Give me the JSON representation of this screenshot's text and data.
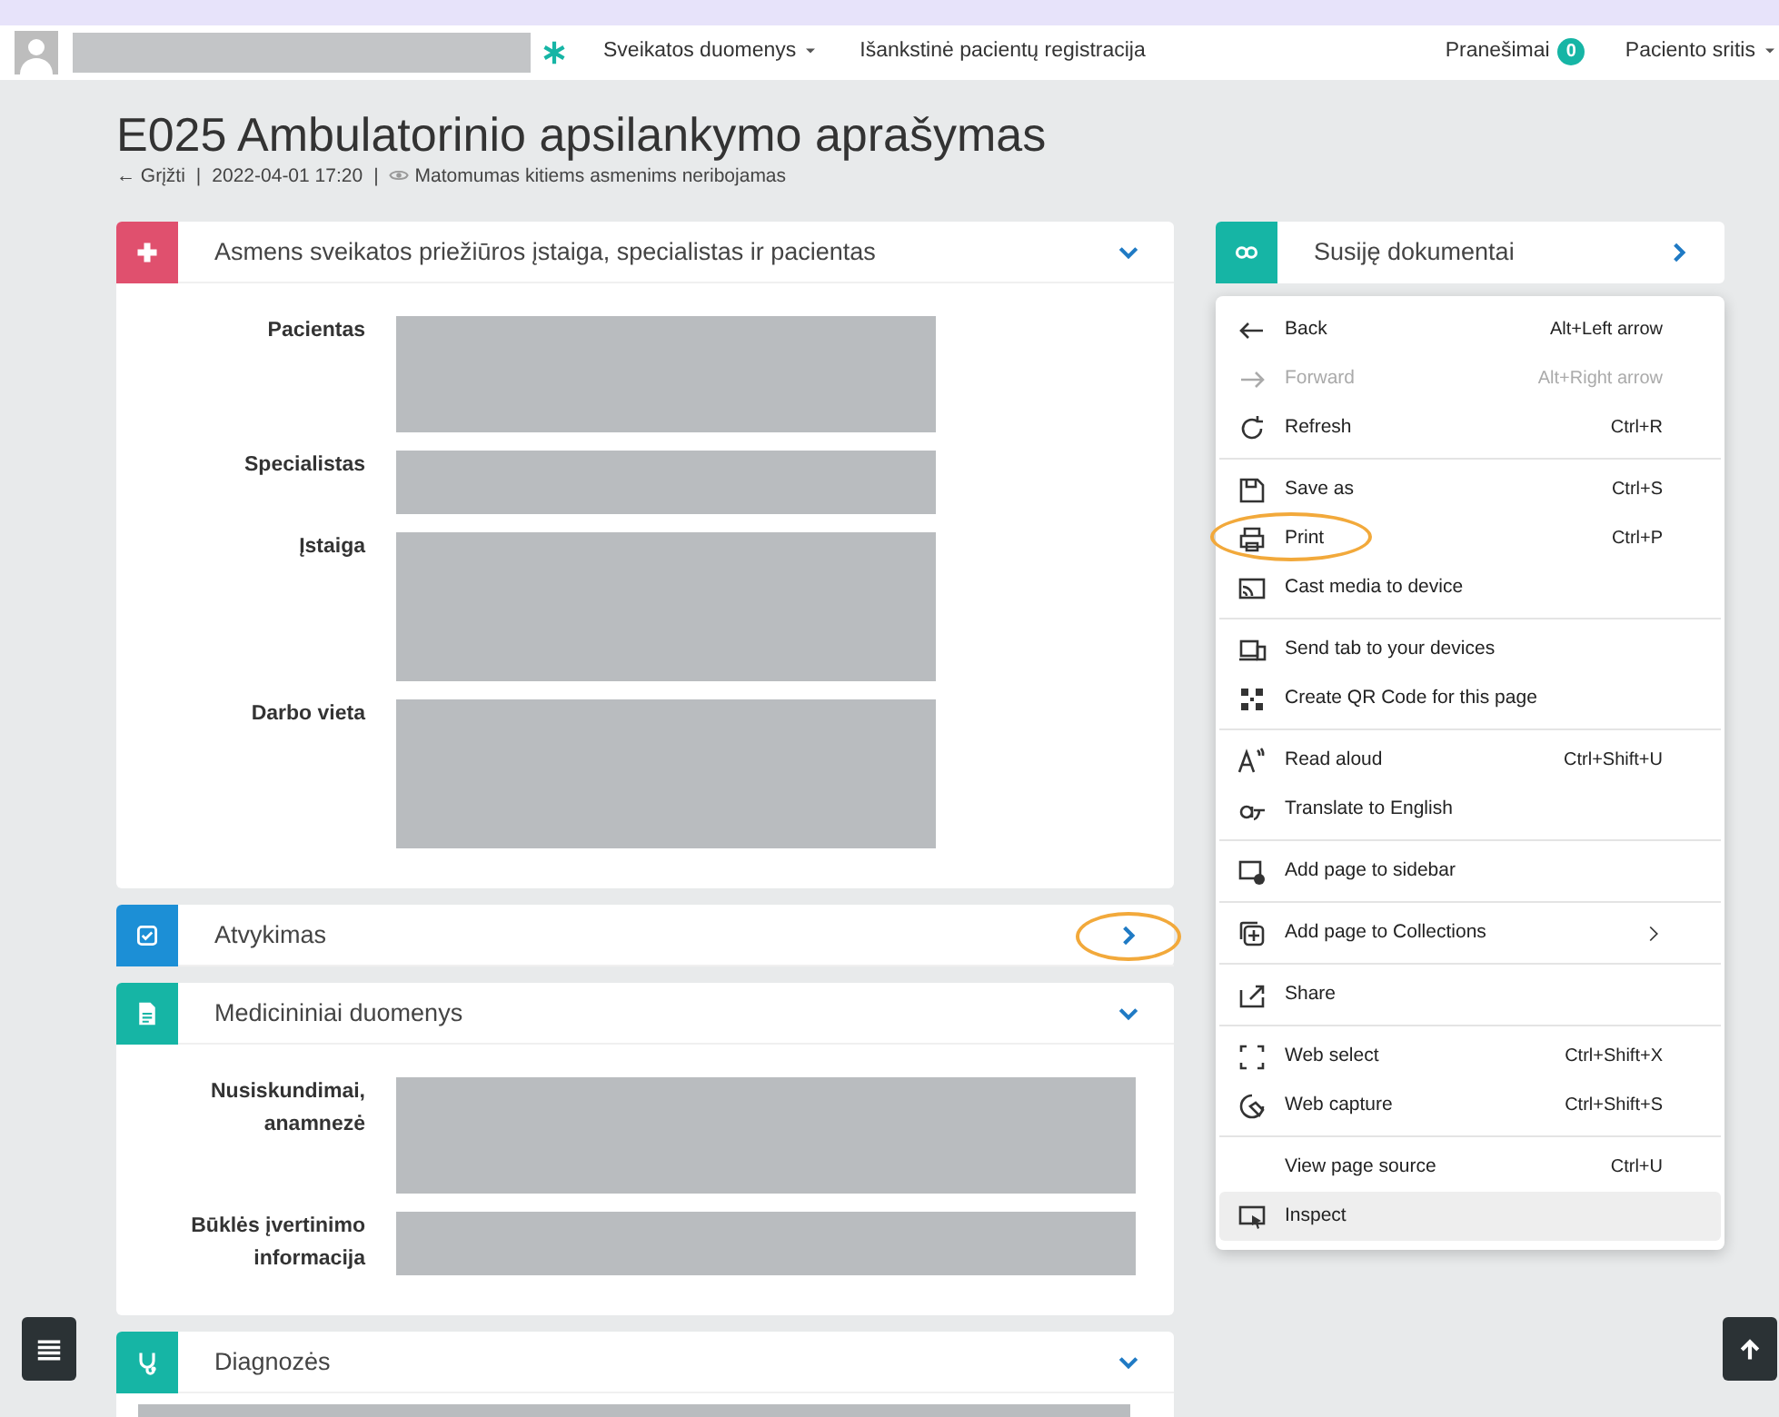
{
  "navbar": {
    "links": [
      {
        "label": "Sveikatos duomenys",
        "dropdown": true
      },
      {
        "label": "Išankstinė pacientų registracija",
        "dropdown": false
      }
    ],
    "notifications": {
      "label": "Pranešimai",
      "count": "0"
    },
    "account": {
      "label": "Paciento sritis",
      "dropdown": true
    }
  },
  "page": {
    "title": "E025 Ambulatorinio apsilankymo aprašymas",
    "back": "← Grįžti",
    "separator_1": "|",
    "date": "2022-04-01 17:20",
    "separator_2": "|",
    "visibility": "Matomumas kitiems asmenims neribojamas"
  },
  "sections": [
    {
      "title": "Asmens sveikatos priežiūros įstaiga, specialistas ir pacientas",
      "color": "#e0506e",
      "expanded": true,
      "highlighted": false,
      "fields": [
        "Pacientas",
        "Specialistas",
        "Įstaiga",
        "Darbo vieta"
      ]
    },
    {
      "title": "Atvykimas",
      "color": "#1c8fd6",
      "expanded": false,
      "highlighted": true
    },
    {
      "title": "Medicininiai duomenys",
      "color": "#16b5a5",
      "expanded": true,
      "highlighted": false,
      "fields": [
        "Nusiskundimai, anamnezė",
        "Būklės įvertinimo informacija"
      ]
    },
    {
      "title": "Diagnozės",
      "color": "#16b5a5",
      "expanded": true,
      "highlighted": false
    }
  ],
  "related": {
    "title": "Susiję dokumentai"
  },
  "context_menu": {
    "groups": [
      {
        "items": [
          {
            "label": "Back",
            "shortcut": "Alt+Left arrow",
            "disabled": false,
            "submenu": false,
            "hovered": false,
            "highlighted": false
          },
          {
            "label": "Forward",
            "shortcut": "Alt+Right arrow",
            "disabled": true,
            "submenu": false,
            "hovered": false,
            "highlighted": false
          },
          {
            "label": "Refresh",
            "shortcut": "Ctrl+R",
            "disabled": false,
            "submenu": false,
            "hovered": false,
            "highlighted": false
          }
        ]
      },
      {
        "items": [
          {
            "label": "Save as",
            "shortcut": "Ctrl+S",
            "disabled": false,
            "submenu": false,
            "hovered": false,
            "highlighted": false
          },
          {
            "label": "Print",
            "shortcut": "Ctrl+P",
            "disabled": false,
            "submenu": false,
            "hovered": false,
            "highlighted": true
          },
          {
            "label": "Cast media to device",
            "disabled": false,
            "submenu": false,
            "hovered": false,
            "highlighted": false
          }
        ]
      },
      {
        "items": [
          {
            "label": "Send tab to your devices",
            "disabled": false,
            "submenu": false,
            "hovered": false,
            "highlighted": false
          },
          {
            "label": "Create QR Code for this page",
            "disabled": false,
            "submenu": false,
            "hovered": false,
            "highlighted": false
          }
        ]
      },
      {
        "items": [
          {
            "label": "Read aloud",
            "shortcut": "Ctrl+Shift+U",
            "disabled": false,
            "submenu": false,
            "hovered": false,
            "highlighted": false
          },
          {
            "label": "Translate to English",
            "disabled": false,
            "submenu": false,
            "hovered": false,
            "highlighted": false
          }
        ]
      },
      {
        "items": [
          {
            "label": "Add page to sidebar",
            "disabled": false,
            "submenu": false,
            "hovered": false,
            "highlighted": false
          }
        ]
      },
      {
        "items": [
          {
            "label": "Add page to Collections",
            "disabled": false,
            "submenu": true,
            "hovered": false,
            "highlighted": false
          }
        ]
      },
      {
        "items": [
          {
            "label": "Share",
            "disabled": false,
            "submenu": false,
            "hovered": false,
            "highlighted": false
          }
        ]
      },
      {
        "items": [
          {
            "label": "Web select",
            "shortcut": "Ctrl+Shift+X",
            "disabled": false,
            "submenu": false,
            "hovered": false,
            "highlighted": false
          },
          {
            "label": "Web capture",
            "shortcut": "Ctrl+Shift+S",
            "disabled": false,
            "submenu": false,
            "hovered": false,
            "highlighted": false
          }
        ]
      },
      {
        "items": [
          {
            "label": "View page source",
            "shortcut": "Ctrl+U",
            "disabled": false,
            "submenu": false,
            "hovered": false,
            "highlighted": false
          },
          {
            "label": "Inspect",
            "disabled": false,
            "submenu": false,
            "hovered": true,
            "highlighted": false
          }
        ]
      }
    ]
  }
}
